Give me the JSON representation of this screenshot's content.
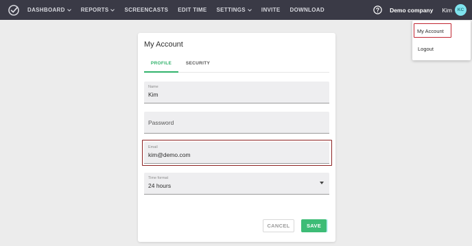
{
  "nav": {
    "logo_icon": "checkmark-clock-icon",
    "items": [
      {
        "label": "DASHBOARD",
        "has_caret": true
      },
      {
        "label": "REPORTS",
        "has_caret": true
      },
      {
        "label": "SCREENCASTS",
        "has_caret": false
      },
      {
        "label": "EDIT TIME",
        "has_caret": false
      },
      {
        "label": "SETTINGS",
        "has_caret": true
      },
      {
        "label": "INVITE",
        "has_caret": false
      },
      {
        "label": "DOWNLOAD",
        "has_caret": false
      }
    ],
    "help_icon": "question-circle-icon",
    "company": "Demo company",
    "user_name": "Kim",
    "avatar_initials": "KC"
  },
  "dropdown": {
    "items": [
      {
        "label": "My Account"
      },
      {
        "label": "Logout"
      }
    ]
  },
  "card": {
    "title": "My Account",
    "tabs": [
      {
        "label": "PROFILE",
        "active": true
      },
      {
        "label": "SECURITY",
        "active": false
      }
    ],
    "fields": {
      "name": {
        "label": "Name",
        "value": "Kim"
      },
      "password": {
        "placeholder": "Password"
      },
      "email": {
        "label": "Email",
        "value": "kim@demo.com"
      },
      "time_format": {
        "label": "Time format",
        "value": "24 hours"
      }
    },
    "buttons": {
      "cancel": "CANCEL",
      "save": "SAVE"
    }
  },
  "colors": {
    "topbar": "#3a3a46",
    "accent_green": "#3dbc76",
    "highlight_red": "#c0222e",
    "avatar_bg": "#7fe3ee"
  }
}
